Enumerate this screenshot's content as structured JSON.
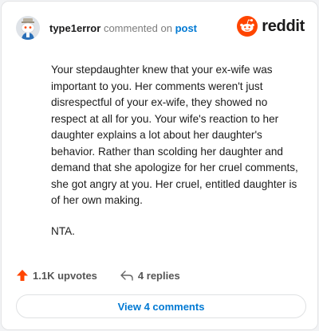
{
  "header": {
    "username": "type1error",
    "action_text": "commented on",
    "post_link": "post",
    "avatar_icon": "snoo-avatar-icon",
    "brand_icon": "reddit-logo-icon",
    "brand_name": "reddit",
    "brand_color": "#ff4500"
  },
  "comment": {
    "paragraphs": [
      "Your stepdaughter knew that your ex-wife was important to you. Her comments weren't just disrespectful of your ex-wife, they showed no respect at all for you. Your wife's reaction to her daughter explains a lot about her daughter's behavior. Rather than scolding her daughter and demand that she apologize for her cruel comments, she got angry at you. Her cruel, entitled daughter is of her own making.",
      "NTA."
    ]
  },
  "actions": {
    "upvotes_label": "1.1K upvotes",
    "upvote_icon": "upvote-arrow-icon",
    "upvote_color": "#ff4500",
    "replies_label": "4 replies",
    "reply_icon": "reply-arrow-icon"
  },
  "view_comments_label": "View 4 comments",
  "link_color": "#0079d3"
}
